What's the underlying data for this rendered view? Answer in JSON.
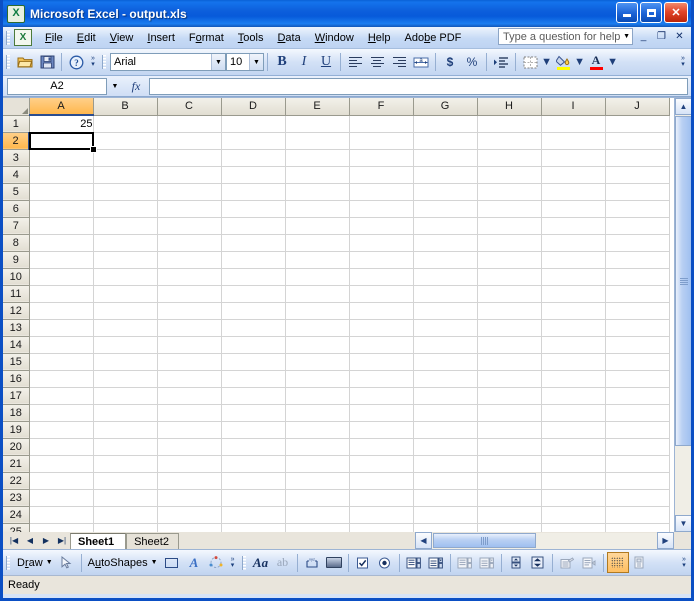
{
  "window": {
    "title": "Microsoft Excel - output.xls",
    "app_icon": "excel-icon",
    "minimize": "_",
    "maximize": "□",
    "close": "✕"
  },
  "menubar": {
    "items": [
      {
        "label": "File",
        "accel": "F"
      },
      {
        "label": "Edit",
        "accel": "E"
      },
      {
        "label": "View",
        "accel": "V"
      },
      {
        "label": "Insert",
        "accel": "I"
      },
      {
        "label": "Format",
        "accel": "o"
      },
      {
        "label": "Tools",
        "accel": "T"
      },
      {
        "label": "Data",
        "accel": "D"
      },
      {
        "label": "Window",
        "accel": "W"
      },
      {
        "label": "Help",
        "accel": "H"
      },
      {
        "label": "Adobe PDF",
        "accel": "b"
      }
    ],
    "help_placeholder": "Type a question for help",
    "doc_minimize": "_",
    "doc_restore": "❐",
    "doc_close": "✕"
  },
  "toolbar": {
    "open_label": "Open",
    "save_label": "Save",
    "help_label": "Microsoft Excel Help",
    "font_name": "Arial",
    "font_size": "10",
    "bold": "B",
    "italic": "I",
    "underline": "U",
    "align_left": "Align Left",
    "align_center": "Center",
    "align_right": "Align Right",
    "merge_center": "Merge and Center",
    "currency": "$",
    "percent": "%",
    "increase_indent": "Increase Indent",
    "borders": "Borders",
    "fill_color": "Fill Color",
    "fill_color_hex": "#ffff00",
    "font_color": "A",
    "font_color_hex": "#ff0000",
    "overflow": "Toolbar Options"
  },
  "formulabar": {
    "name_box": "A2",
    "fx_label": "fx",
    "formula_value": ""
  },
  "grid": {
    "columns": [
      "A",
      "B",
      "C",
      "D",
      "E",
      "F",
      "G",
      "H",
      "I",
      "J"
    ],
    "rows": [
      "1",
      "2",
      "3",
      "4",
      "5",
      "6",
      "7",
      "8",
      "9",
      "10",
      "11",
      "12",
      "13",
      "14",
      "15",
      "16",
      "17",
      "18",
      "19",
      "20",
      "21",
      "22",
      "23",
      "24",
      "25"
    ],
    "selected_cell": "A2",
    "selected_column": "A",
    "selected_row": "2",
    "cells": [
      {
        "ref": "A1",
        "col": 0,
        "row": 0,
        "value": "25",
        "align": "right"
      }
    ]
  },
  "sheettabs": {
    "nav_first": "◀◀",
    "nav_prev": "◀",
    "nav_next": "▶",
    "nav_last": "▶▶",
    "tabs": [
      {
        "label": "Sheet1",
        "active": true
      },
      {
        "label": "Sheet2",
        "active": false
      }
    ]
  },
  "drawbar": {
    "draw_label": "Draw",
    "select_label": "Select Objects",
    "autoshapes_label": "AutoShapes",
    "rectangle_label": "Rectangle",
    "wordart_label": "Insert WordArt",
    "diagram_label": "Insert Diagram",
    "font_large_label": "Aa",
    "font_small_label": "ab",
    "textbox_label": "Text Box",
    "button_label": "Button",
    "checkbox_label": "Check Box",
    "option_label": "Option Button",
    "listbox_label": "List Box",
    "combobox_label": "Combo Box",
    "listbox2_label": "List Box 2",
    "combobox2_label": "Combo Box 2",
    "spinner_label": "Spinner",
    "scrollbar_label": "Scroll Bar",
    "properties_label": "Properties",
    "viewcode_label": "View Code",
    "designmode_label": "Design Mode",
    "toggle_label": "Toggle Grid",
    "overflow": "Toolbar Options"
  },
  "statusbar": {
    "status": "Ready"
  }
}
